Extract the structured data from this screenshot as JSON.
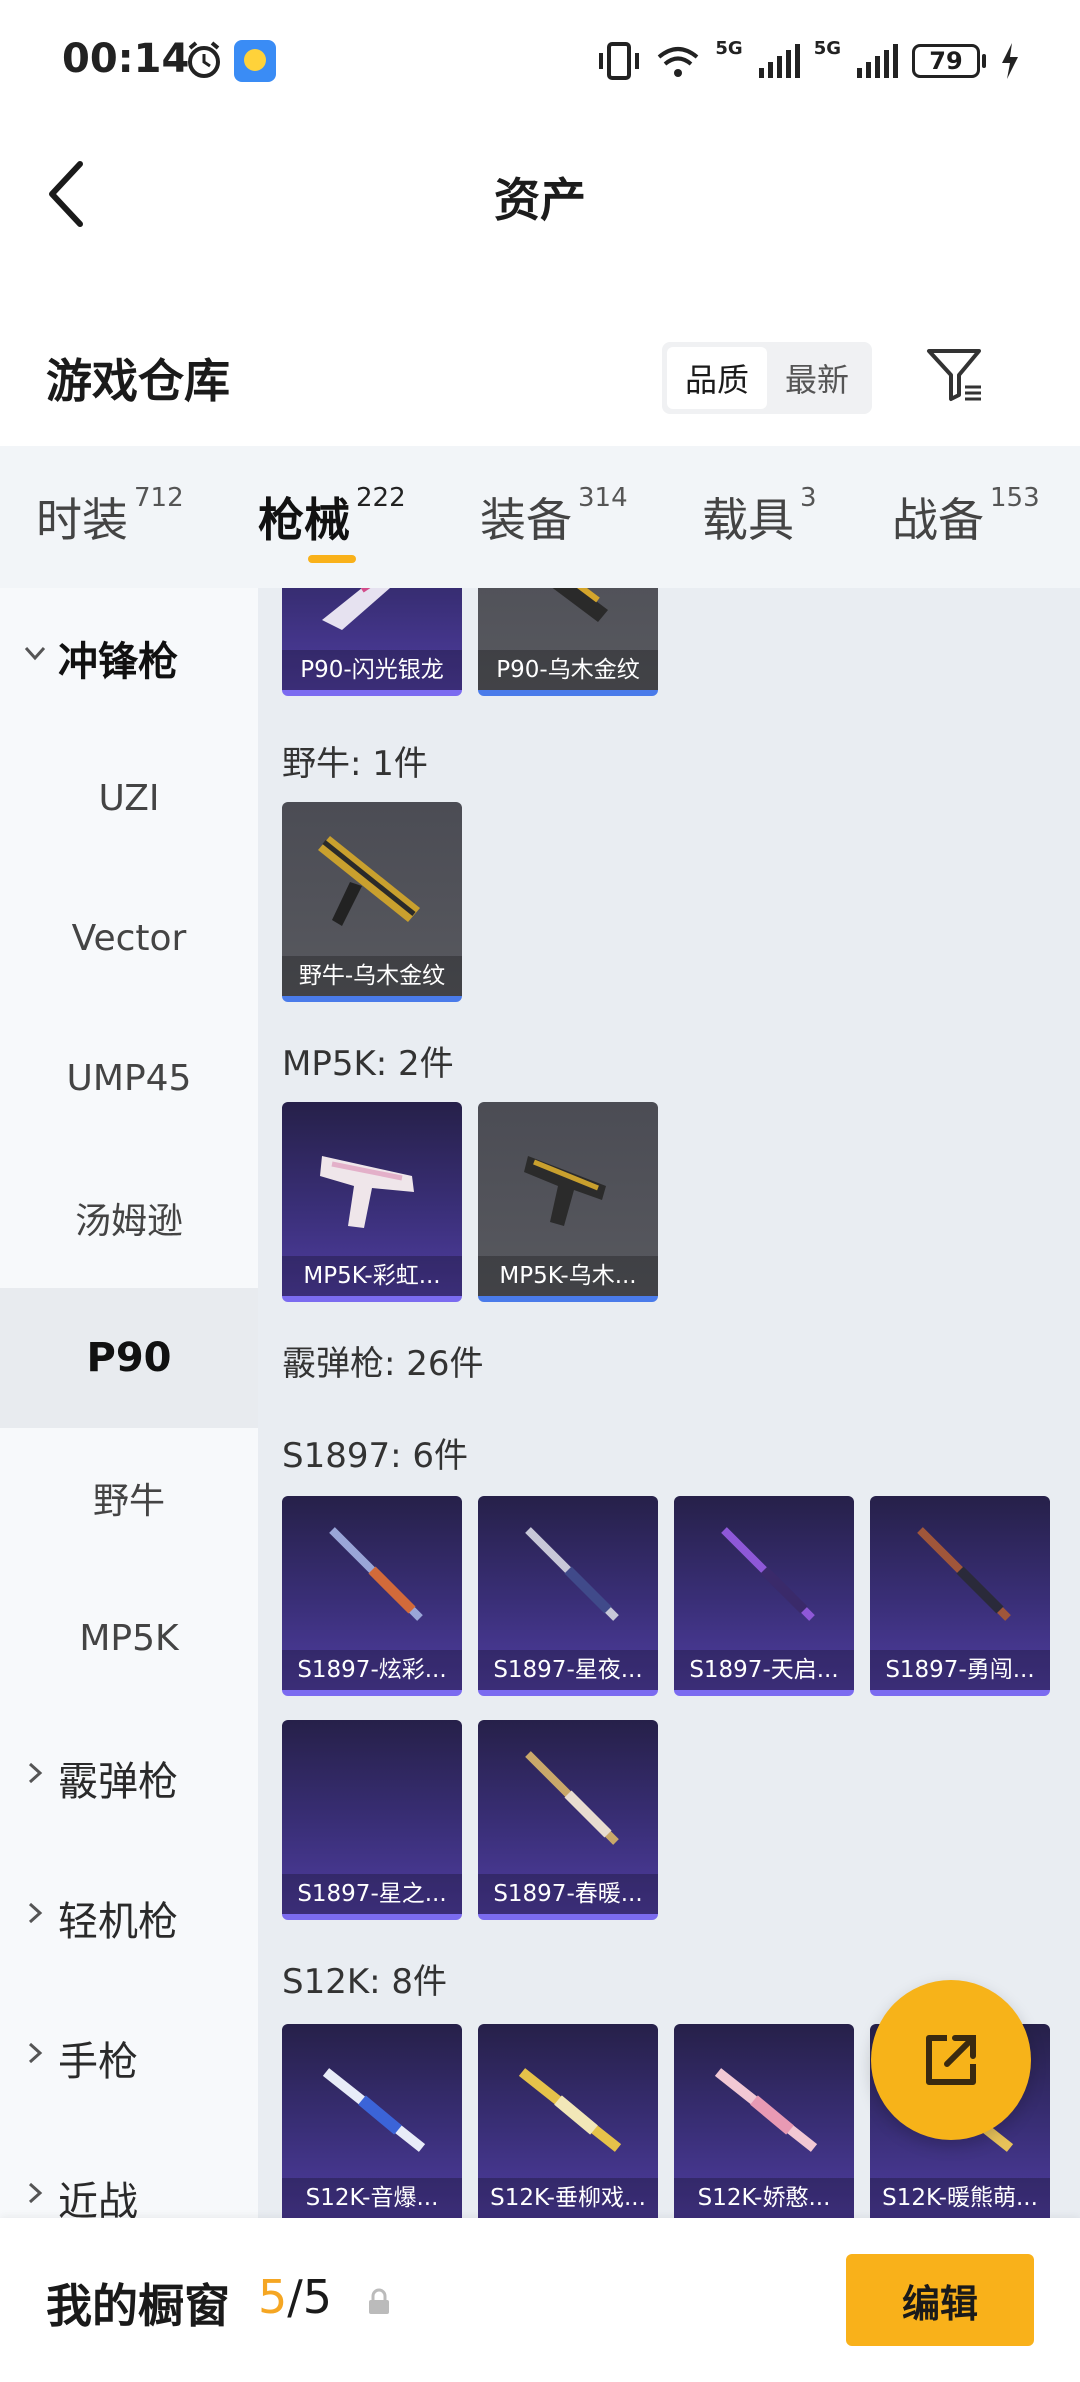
{
  "status_bar": {
    "time": "00:14",
    "net1": "5G",
    "net2": "5G",
    "sig1": "6",
    "battery": "79",
    "icons": [
      "alarm-icon",
      "weather-icon",
      "vibrate-icon",
      "wifi-icon",
      "signal-icon",
      "battery-icon",
      "charging-icon"
    ]
  },
  "nav": {
    "title": "资产"
  },
  "section": {
    "title": "游戏仓库",
    "sort_options": [
      "品质",
      "最新"
    ],
    "active_sort": "品质"
  },
  "tabs": [
    {
      "label": "时装",
      "count": "712"
    },
    {
      "label": "枪械",
      "count": "222"
    },
    {
      "label": "装备",
      "count": "314"
    },
    {
      "label": "载具",
      "count": "3"
    },
    {
      "label": "战备",
      "count": "153"
    }
  ],
  "active_tab": "枪械",
  "sidebar": {
    "items": [
      {
        "label": "冲锋枪",
        "type": "category"
      },
      {
        "label": "UZI",
        "type": "sub"
      },
      {
        "label": "Vector",
        "type": "sub"
      },
      {
        "label": "UMP45",
        "type": "sub"
      },
      {
        "label": "汤姆逊",
        "type": "sub"
      },
      {
        "label": "P90",
        "type": "sub"
      },
      {
        "label": "野牛",
        "type": "sub"
      },
      {
        "label": "MP5K",
        "type": "sub"
      },
      {
        "label": "霰弹枪",
        "type": "category"
      },
      {
        "label": "轻机枪",
        "type": "category"
      },
      {
        "label": "手枪",
        "type": "category"
      },
      {
        "label": "近战",
        "type": "category"
      }
    ],
    "active": "P90"
  },
  "groups": [
    {
      "label": "野牛: 1件"
    },
    {
      "label": "MP5K: 2件"
    },
    {
      "label": "霰弹枪: 26件"
    },
    {
      "label": "S1897: 6件"
    },
    {
      "label": "S12K: 8件"
    }
  ],
  "items": {
    "p90": [
      "P90-闪光银龙",
      "P90-乌木金纹"
    ],
    "bison": [
      "野牛-乌木金纹"
    ],
    "mp5k": [
      "MP5K-彩虹...",
      "MP5K-乌木..."
    ],
    "s1897": [
      "S1897-炫彩...",
      "S1897-星夜...",
      "S1897-天启...",
      "S1897-勇闯...",
      "S1897-星之...",
      "S1897-春暖..."
    ],
    "s12k": [
      "S12K-音爆...",
      "S12K-垂柳戏...",
      "S12K-娇憨...",
      "S12K-暖熊萌..."
    ]
  },
  "bottom": {
    "label": "我的橱窗",
    "current": "5",
    "sep": "/",
    "total": "5",
    "edit_label": "编辑"
  },
  "colors": {
    "accent": "#f9b11a",
    "rare_purple": "#4f3da0",
    "rare_blue": "#4a7bea"
  }
}
